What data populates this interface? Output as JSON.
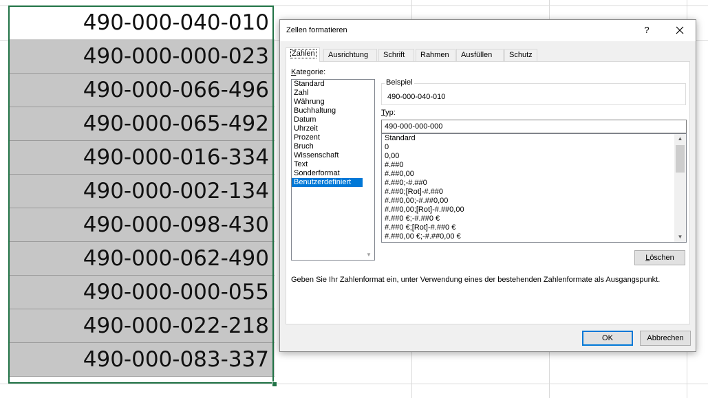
{
  "sheet": {
    "cells": [
      "490-000-040-010",
      "490-000-000-023",
      "490-000-066-496",
      "490-000-065-492",
      "490-000-016-334",
      "490-000-002-134",
      "490-000-098-430",
      "490-000-062-490",
      "490-000-000-055",
      "490-000-022-218",
      "490-000-083-337"
    ]
  },
  "dialog": {
    "title": "Zellen formatieren",
    "help": "?",
    "close": "✕",
    "tabs": [
      "Zahlen",
      "Ausrichtung",
      "Schrift",
      "Rahmen",
      "Ausfüllen",
      "Schutz"
    ],
    "active_tab": "Zahlen",
    "kategorie_label_underlined": "K",
    "kategorie_label_rest": "ategorie:",
    "categories": [
      "Standard",
      "Zahl",
      "Währung",
      "Buchhaltung",
      "Datum",
      "Uhrzeit",
      "Prozent",
      "Bruch",
      "Wissenschaft",
      "Text",
      "Sonderformat",
      "Benutzerdefiniert"
    ],
    "selected_category": "Benutzerdefiniert",
    "beispiel_label": "Beispiel",
    "beispiel_value": "490-000-040-010",
    "typ_label_underlined": "T",
    "typ_label_rest": "yp:",
    "typ_value": "490-000-000-000",
    "formats": [
      "Standard",
      "0",
      "0,00",
      "#.##0",
      "#.##0,00",
      "#.##0;-#.##0",
      "#.##0;[Rot]-#.##0",
      "#.##0,00;-#.##0,00",
      "#.##0,00;[Rot]-#.##0,00",
      "#.##0 €;-#.##0 €",
      "#.##0 €;[Rot]-#.##0 €",
      "#.##0,00 €;-#.##0,00 €"
    ],
    "delete_button_underlined": "L",
    "delete_button_rest": "öschen",
    "hint": "Geben Sie Ihr Zahlenformat ein, unter Verwendung eines der bestehenden Zahlenformate als Ausgangspunkt.",
    "ok_label": "OK",
    "cancel_label": "Abbrechen"
  }
}
